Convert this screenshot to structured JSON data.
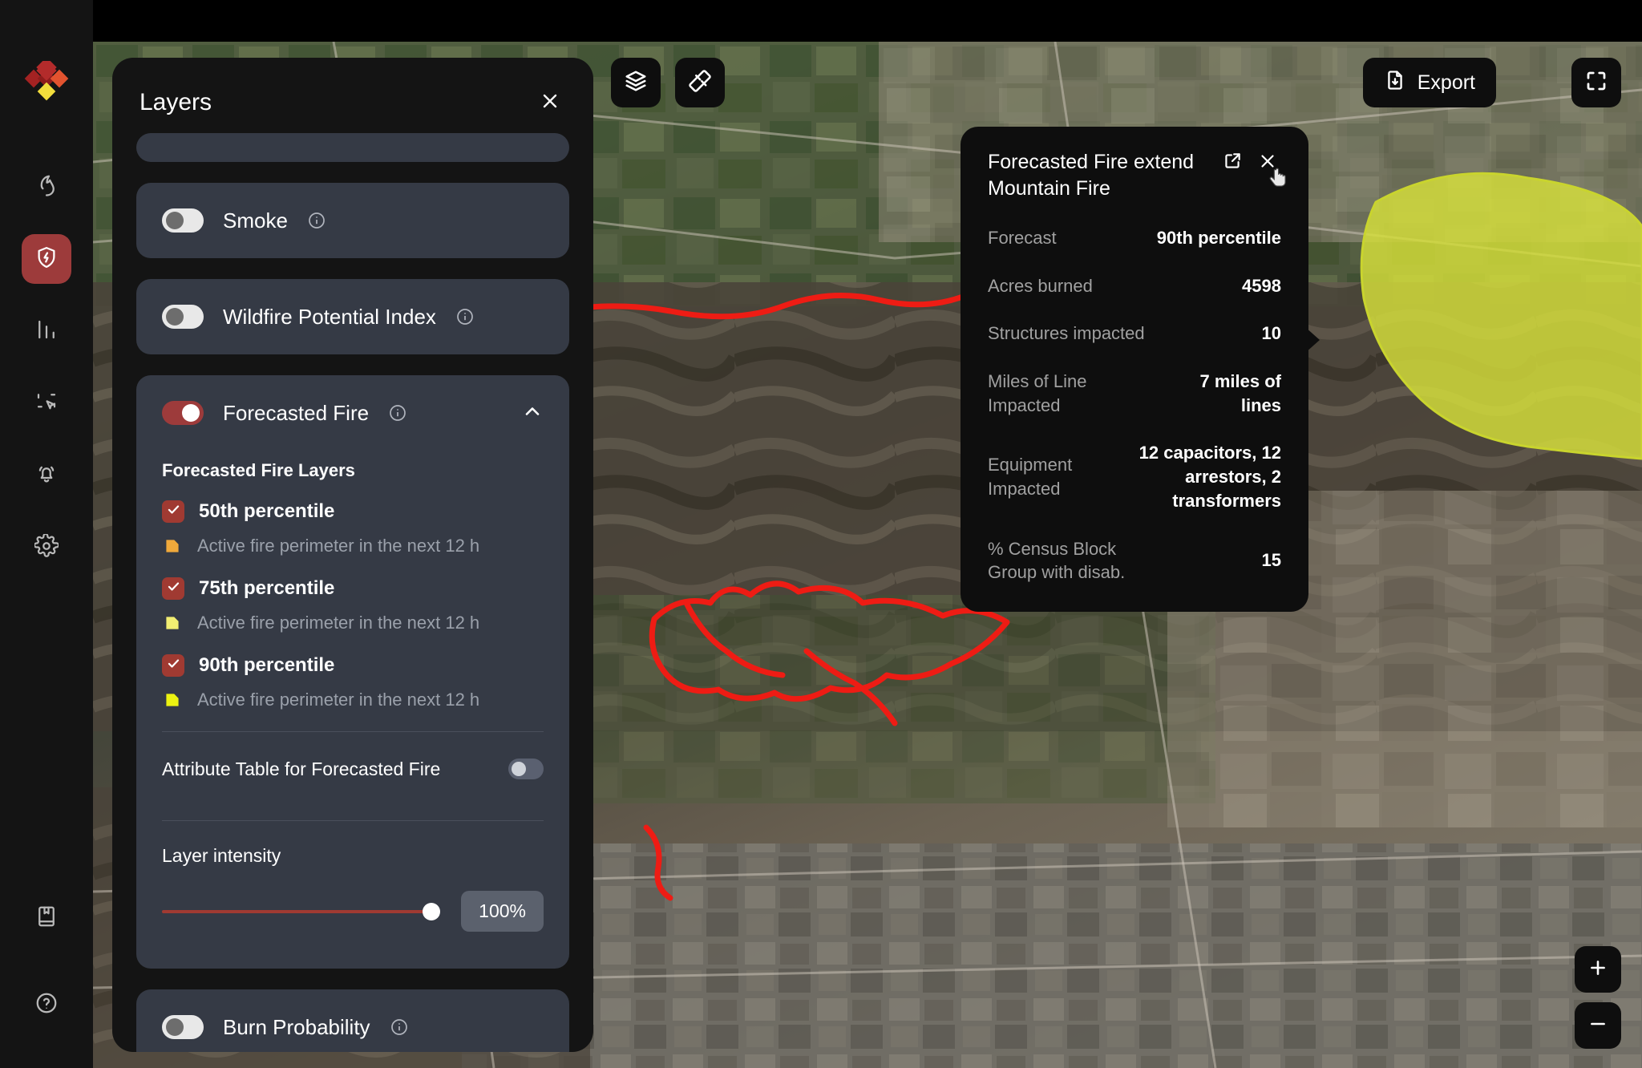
{
  "app": {
    "logo_name": "app-logo",
    "brand_color": "#b32b2b",
    "accent_color": "#9d3b3b"
  },
  "sidebar": {
    "items": [
      {
        "icon": "flame-icon",
        "name": "sidebar-item-fire",
        "active": false
      },
      {
        "icon": "shield-bolt-icon",
        "name": "sidebar-item-risk",
        "active": true
      },
      {
        "icon": "bar-chart-icon",
        "name": "sidebar-item-analytics",
        "active": false
      },
      {
        "icon": "selection-cursor-icon",
        "name": "sidebar-item-select",
        "active": false
      },
      {
        "icon": "bell-icon",
        "name": "sidebar-item-alerts",
        "active": false
      },
      {
        "icon": "gear-icon",
        "name": "sidebar-item-settings",
        "active": false
      }
    ],
    "bottom_items": [
      {
        "icon": "book-icon",
        "name": "sidebar-item-library"
      },
      {
        "icon": "help-circle-icon",
        "name": "sidebar-item-help"
      }
    ]
  },
  "map_toolbar": {
    "layers_icon": "layers-stack-icon",
    "measure_icon": "ruler-icon",
    "export_label": "Export",
    "export_icon": "file-download-icon",
    "fullscreen_icon": "fullscreen-icon",
    "zoom_in_label": "+",
    "zoom_out_label": "−"
  },
  "layers_panel": {
    "title": "Layers",
    "close_icon": "close-icon",
    "cards": [
      {
        "name": "smoke",
        "label": "Smoke",
        "toggle_on": false,
        "info_icon": "info-icon"
      },
      {
        "name": "wildfire-potential-index",
        "label": "Wildfire Potential Index",
        "toggle_on": false,
        "info_icon": "info-icon"
      }
    ],
    "forecasted_fire": {
      "label": "Forecasted Fire",
      "toggle_on": true,
      "info_icon": "info-icon",
      "collapse_icon": "chevron-up-icon",
      "sub_title": "Forecasted Fire Layers",
      "percentiles": [
        {
          "label": "50th percentile",
          "checked": true,
          "description": "Active fire perimeter in the next 12 h",
          "swatch_color": "#f0a93b"
        },
        {
          "label": "75th percentile",
          "checked": true,
          "description": "Active fire perimeter in the next 12 h",
          "swatch_color": "#f2ee72"
        },
        {
          "label": "90th percentile",
          "checked": true,
          "description": "Active fire perimeter in the next 12 h",
          "swatch_color": "#ecf211"
        }
      ],
      "attribute_table_label": "Attribute Table for Forecasted Fire",
      "attribute_table_on": false,
      "intensity_label": "Layer intensity",
      "intensity_value": "100%",
      "intensity_percent": 100
    },
    "next_card_label": "Burn Probability"
  },
  "map_popup": {
    "title": "Forecasted Fire extend Mountain Fire",
    "open_icon": "external-link-icon",
    "close_icon": "close-icon",
    "rows": [
      {
        "key": "Forecast",
        "value": "90th percentile"
      },
      {
        "key": "Acres burned",
        "value": "4598"
      },
      {
        "key": "Structures impacted",
        "value": "10"
      },
      {
        "key": "Miles of Line Impacted",
        "value": "7 miles of lines"
      },
      {
        "key": "Equipment Impacted",
        "value": "12 capacitors, 12 arrestors, 2 transformers"
      },
      {
        "key": "% Census Block Group with disab.",
        "value": "15"
      }
    ]
  },
  "map": {
    "fire_perimeter_color": "#ee1c14",
    "forecast_polygon_color": "#d7e03a"
  }
}
